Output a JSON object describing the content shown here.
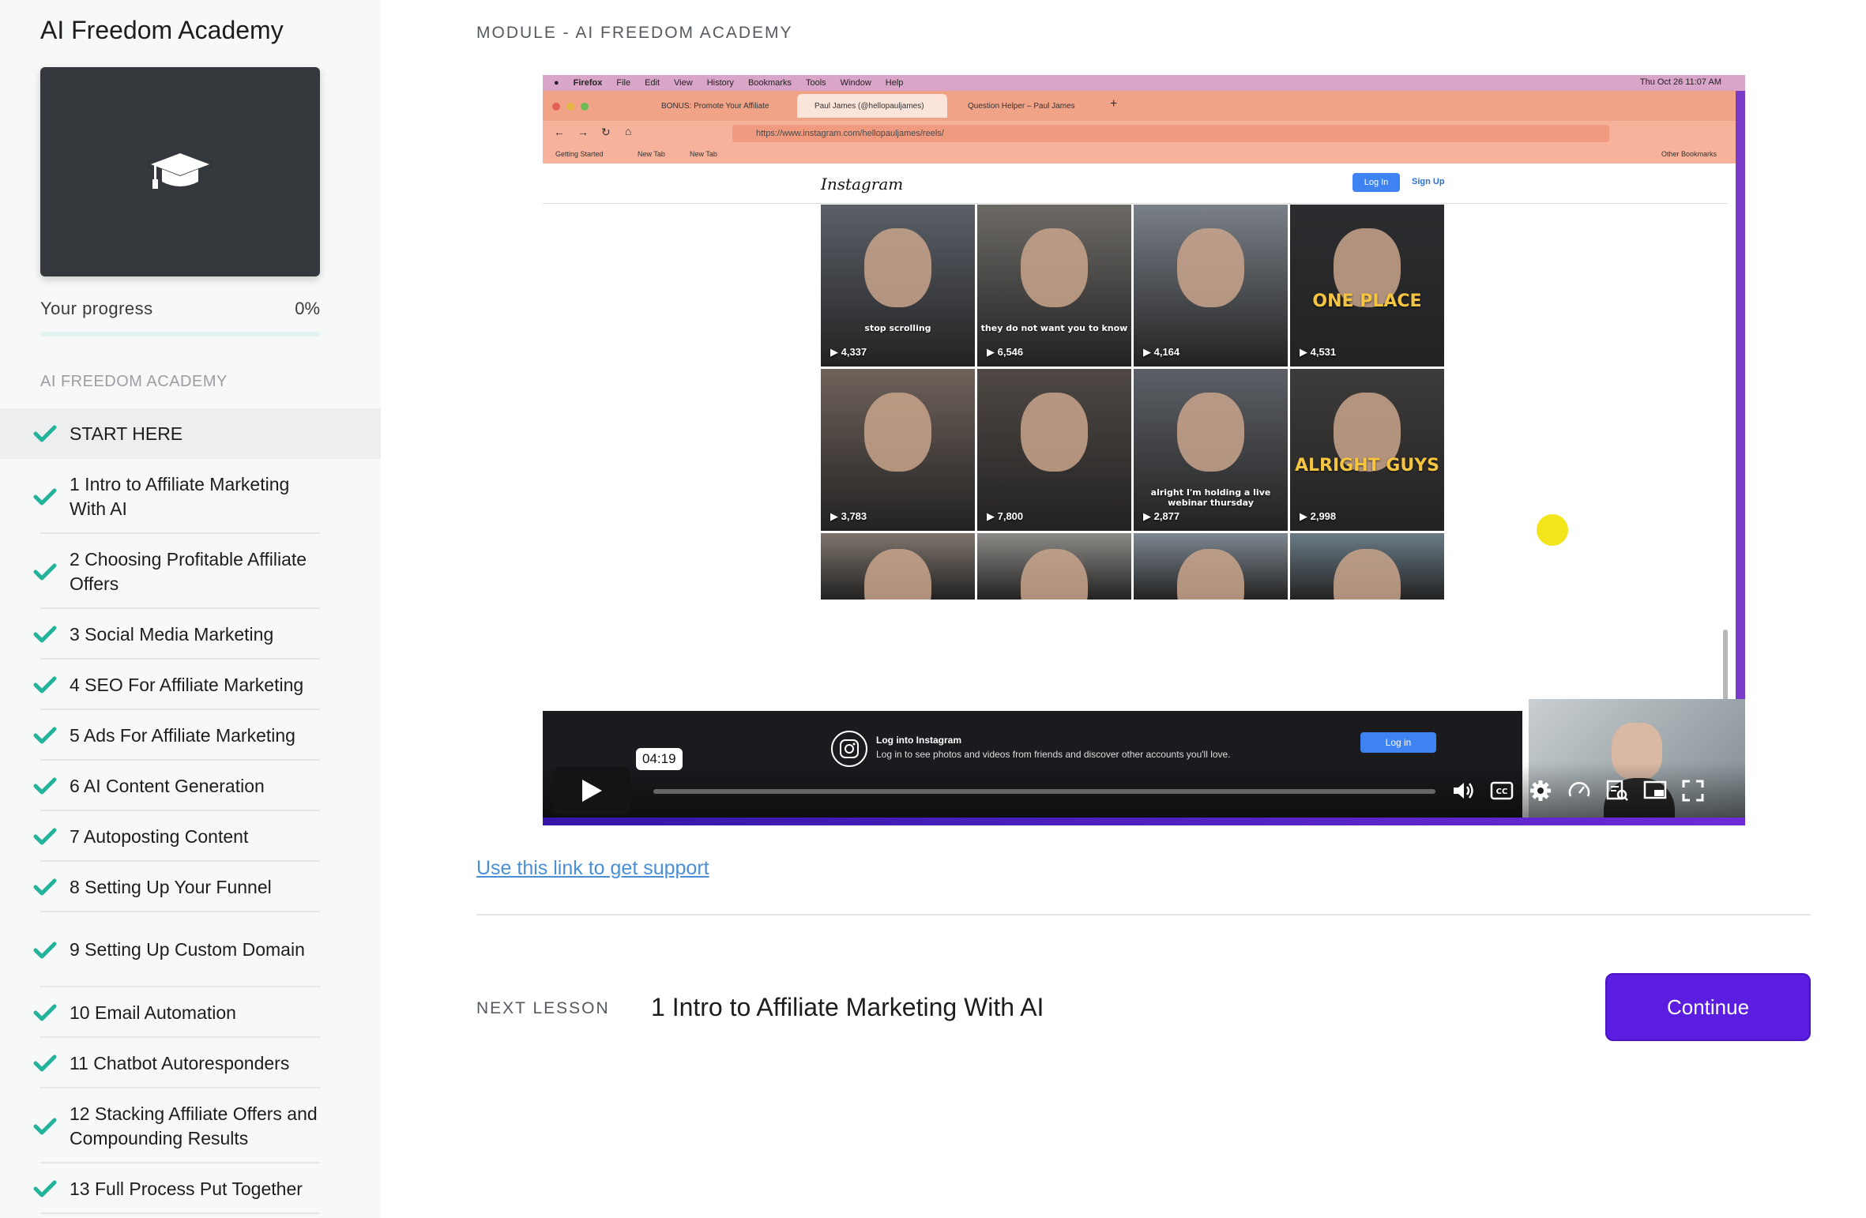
{
  "sidebar": {
    "course_title": "AI Freedom Academy",
    "thumbnail_icon": "graduation-cap-icon",
    "progress_label": "Your progress",
    "progress_value": "0%",
    "progress_fraction": 0,
    "section_heading": "AI FREEDOM ACADEMY",
    "check_color": "#23b39b",
    "lessons": [
      {
        "label": "START HERE"
      },
      {
        "label": "1 Intro to Affiliate Marketing With AI"
      },
      {
        "label": "2 Choosing Profitable Affiliate Offers"
      },
      {
        "label": "3 Social Media Marketing"
      },
      {
        "label": "4 SEO For Affiliate Marketing"
      },
      {
        "label": "5 Ads For Affiliate Marketing"
      },
      {
        "label": "6 AI Content Generation"
      },
      {
        "label": "7 Autoposting Content"
      },
      {
        "label": "8 Setting Up Your Funnel"
      },
      {
        "label": "9 Setting Up Custom Domain"
      },
      {
        "label": "10 Email Automation"
      },
      {
        "label": "11 Chatbot Autoresponders"
      },
      {
        "label": "12 Stacking Affiliate Offers and Compounding Results"
      },
      {
        "label": "13 Full Process Put Together"
      }
    ]
  },
  "main": {
    "module_crumb": "MODULE - AI FREEDOM ACADEMY",
    "support_link": "Use this link to get support",
    "next_label": "NEXT LESSON",
    "next_title": "1 Intro to Affiliate Marketing With AI",
    "continue_label": "Continue",
    "accent_color": "#5b1de0"
  },
  "video": {
    "menubar": {
      "items": [
        "Firefox",
        "File",
        "Edit",
        "View",
        "History",
        "Bookmarks",
        "Tools",
        "Window",
        "Help"
      ],
      "clock": "Thu Oct 26  11:07 AM"
    },
    "tabs": [
      {
        "label": "BONUS: Promote Your Affiliate"
      },
      {
        "label": "Paul James (@hellopauljames)"
      },
      {
        "label": "Question Helper – Paul James"
      }
    ],
    "url": "https://www.instagram.com/hellopauljames/reels/",
    "bookmarks": [
      "Getting Started",
      "New Tab",
      "New Tab"
    ],
    "other_bookmarks": "Other Bookmarks",
    "instagram": {
      "logo": "Instagram",
      "login": "Log In",
      "signup": "Sign Up",
      "reels": [
        {
          "views": "4,337",
          "caption": "stop scrolling",
          "style": "small"
        },
        {
          "views": "6,546",
          "caption": "they do not want you to know",
          "style": "small"
        },
        {
          "views": "4,164",
          "caption": "",
          "style": ""
        },
        {
          "views": "4,531",
          "caption": "ONE PLACE",
          "style": "big"
        },
        {
          "views": "3,783",
          "caption": "",
          "style": ""
        },
        {
          "views": "7,800",
          "caption": "",
          "style": ""
        },
        {
          "views": "2,877",
          "caption": "alright I'm holding a live webinar thursday",
          "style": "small"
        },
        {
          "views": "2,998",
          "caption": "ALRIGHT GUYS",
          "style": "big"
        },
        {
          "views": "",
          "caption": "",
          "style": ""
        },
        {
          "views": "",
          "caption": "",
          "style": ""
        },
        {
          "views": "",
          "caption": "",
          "style": ""
        },
        {
          "views": "",
          "caption": "",
          "style": ""
        }
      ],
      "banner_title": "Log into Instagram",
      "banner_sub": "Log in to see photos and videos from friends and discover other accounts you'll love.",
      "banner_login": "Log in"
    },
    "player": {
      "time": "04:19",
      "progress_fraction": 0.0,
      "controls": [
        "play-icon",
        "volume-icon",
        "captions-icon",
        "settings-icon",
        "speed-icon",
        "transcript-icon",
        "picture-in-picture-icon",
        "fullscreen-icon"
      ]
    }
  }
}
